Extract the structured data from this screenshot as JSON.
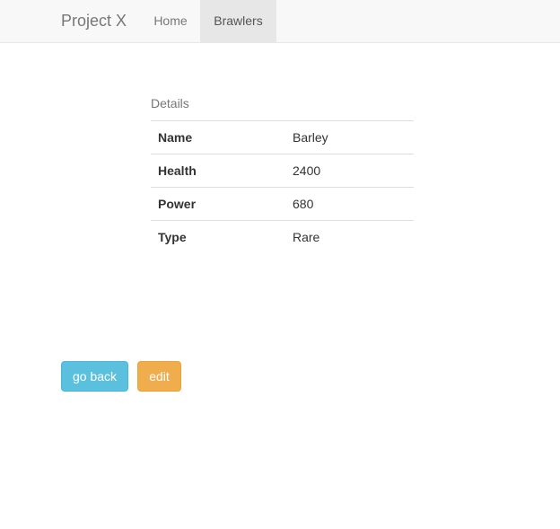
{
  "navbar": {
    "brand": "Project X",
    "links": [
      {
        "label": "Home",
        "active": false
      },
      {
        "label": "Brawlers",
        "active": true
      }
    ]
  },
  "details": {
    "caption": "Details",
    "rows": [
      {
        "key": "Name",
        "value": "Barley"
      },
      {
        "key": "Health",
        "value": "2400"
      },
      {
        "key": "Power",
        "value": "680"
      },
      {
        "key": "Type",
        "value": "Rare"
      }
    ]
  },
  "actions": {
    "back_label": "go back",
    "edit_label": "edit"
  },
  "colors": {
    "info": "#5bc0de",
    "warning": "#f0ad4e",
    "navbar_bg": "#f8f8f8"
  }
}
